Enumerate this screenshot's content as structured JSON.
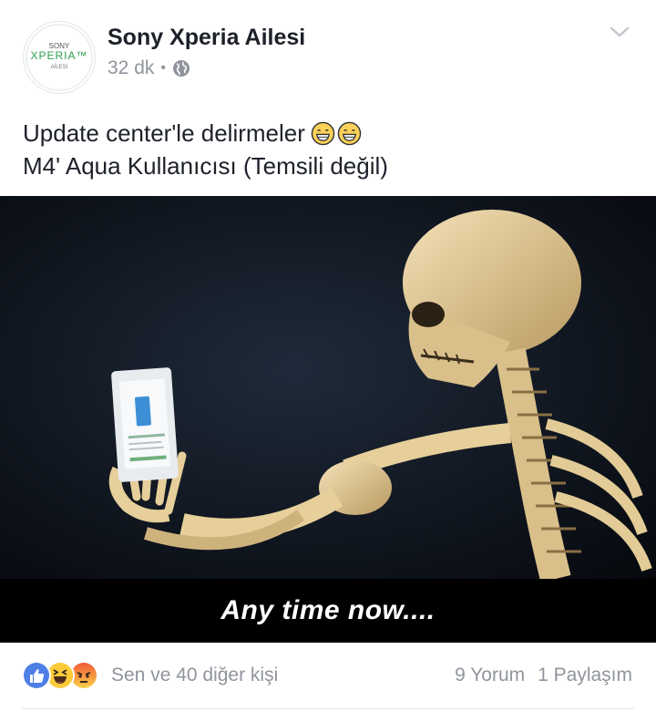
{
  "post": {
    "page_name": "Sony Xperia Ailesi",
    "timestamp": "32 dk",
    "separator": "•",
    "audience_icon": "globe-icon",
    "menu_icon": "chevron-down-icon",
    "avatar": {
      "logo_top": "SONY",
      "logo_main": "XPERIA™",
      "logo_sub": "AİLESİ",
      "accent_color": "#2e9e4a"
    },
    "caption": {
      "line1": "Update center'le delirmeler",
      "line2": "M4' Aqua Kullanıcısı (Temsili değil)",
      "emojis": [
        "grinning-face-icon",
        "grinning-face-icon"
      ]
    },
    "image": {
      "alt_subject": "skeleton-holding-phone",
      "caption_text": "Any time now...."
    },
    "footer": {
      "reaction_icons": [
        "like-icon",
        "haha-icon",
        "angry-icon"
      ],
      "reactions_text": "Sen ve 40 diğer kişi",
      "comments": "9 Yorum",
      "shares": "1 Paylaşım"
    },
    "colors": {
      "like_blue": "#4267b2",
      "meta_gray": "#90949c",
      "text": "#1d2129"
    }
  }
}
